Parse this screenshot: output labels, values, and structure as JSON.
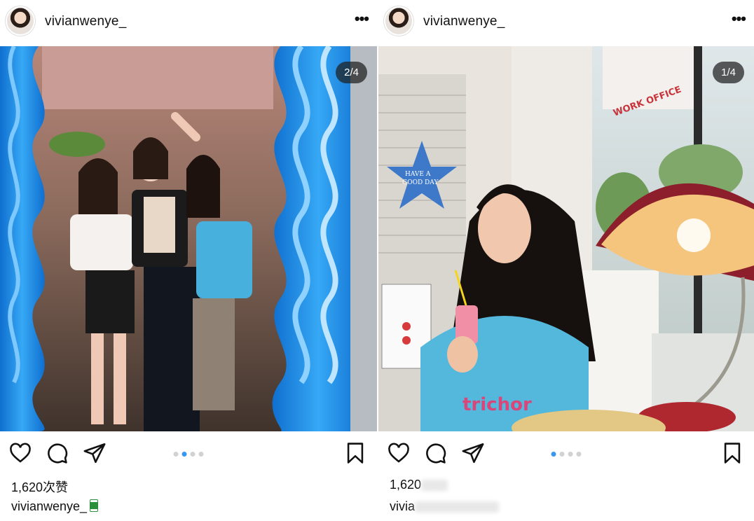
{
  "posts": [
    {
      "username": "vivianwenye_",
      "counter": "2/4",
      "likes": "1,620次赞",
      "caption_user": "vivianwenye_",
      "active_slide": 2,
      "slide_count": 4
    },
    {
      "username": "vivianwenye_",
      "counter": "1/4",
      "likes_visible": "1,620",
      "caption_user_visible": "vivia",
      "active_slide": 1,
      "slide_count": 4
    }
  ],
  "colors": {
    "accent_dot": "#3897f0",
    "inactive_dot": "#d2d2d2",
    "mirror_blue": "#1e8fe8",
    "shirt_blue": "#3cb6d8"
  },
  "photos": {
    "left_sign_text": "",
    "right_star_text": "HAVE A GOOD DAY",
    "right_window_text": "WORK OFFICE",
    "right_shirt_text": "trichor"
  },
  "icons": [
    "heart-icon",
    "comment-icon",
    "share-icon",
    "bookmark-icon",
    "more-icon"
  ]
}
